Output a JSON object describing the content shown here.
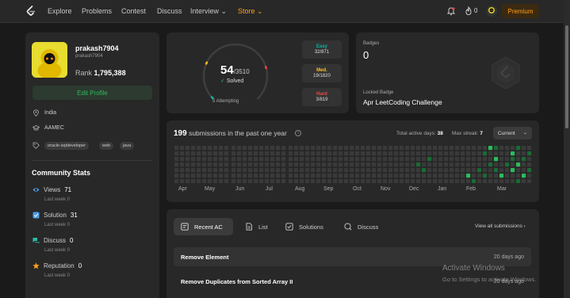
{
  "nav": {
    "items": [
      "Explore",
      "Problems",
      "Contest",
      "Discuss",
      "Interview",
      "Store"
    ],
    "streak": "0",
    "premium": "Premium"
  },
  "profile": {
    "username": "prakash7904",
    "handle": "prakash7904",
    "rank_label": "Rank",
    "rank_value": "1,795,388",
    "edit_label": "Edit Profile",
    "location": "India",
    "school": "AAMEC",
    "tags": [
      "oracle-sqldeveloper",
      "web",
      "java"
    ]
  },
  "community": {
    "title": "Community Stats",
    "stats": [
      {
        "label": "Views",
        "value": "71",
        "sub": "Last week 0",
        "icon": "eye-icon"
      },
      {
        "label": "Solution",
        "value": "31",
        "sub": "Last week 0",
        "icon": "checkbox-icon"
      },
      {
        "label": "Discuss",
        "value": "0",
        "sub": "Last week 0",
        "icon": "chat-icon"
      },
      {
        "label": "Reputation",
        "value": "0",
        "sub": "Last week 0",
        "icon": "star-icon"
      }
    ]
  },
  "progress": {
    "solved": "54",
    "total": "/3510",
    "solved_label": "Solved",
    "attempting": "5 Attempting",
    "solved_fraction": 0.0154,
    "difficulties": [
      {
        "name": "Easy",
        "value": "32/871",
        "color": "#00b8a3"
      },
      {
        "name": "Med.",
        "value": "19/1820",
        "color": "#ffc01e"
      },
      {
        "name": "Hard",
        "value": "3/819",
        "color": "#ef4743"
      }
    ]
  },
  "badges": {
    "label": "Badges",
    "count": "0",
    "locked_label": "Locked Badge",
    "locked_name": "Apr LeetCoding Challenge"
  },
  "submissions": {
    "count": "199",
    "text": "submissions in the past one year",
    "active_label": "Total active days:",
    "active_value": "38",
    "streak_label": "Max streak:",
    "streak_value": "7",
    "current": "Current",
    "months": [
      "Apr",
      "May",
      "Jun",
      "Jul",
      "Aug",
      "Sep",
      "Oct",
      "Nov",
      "Dec",
      "Jan",
      "Feb",
      "Mar"
    ]
  },
  "recent": {
    "tabs": [
      "Recent AC",
      "List",
      "Solutions",
      "Discuss"
    ],
    "view_all": "View all submissions",
    "rows": [
      {
        "title": "Remove Element",
        "date": "20 days ago"
      },
      {
        "title": "Remove Duplicates from Sorted Array II",
        "date": "20 days ago"
      }
    ]
  },
  "watermark": {
    "line1": "Activate Windows",
    "line2": "Go to Settings to activate Windows."
  },
  "colors": {
    "accent": "#ffa116",
    "green": "#2cbb5d",
    "easy": "#00b8a3",
    "medium": "#ffc01e",
    "hard": "#ef4743"
  }
}
